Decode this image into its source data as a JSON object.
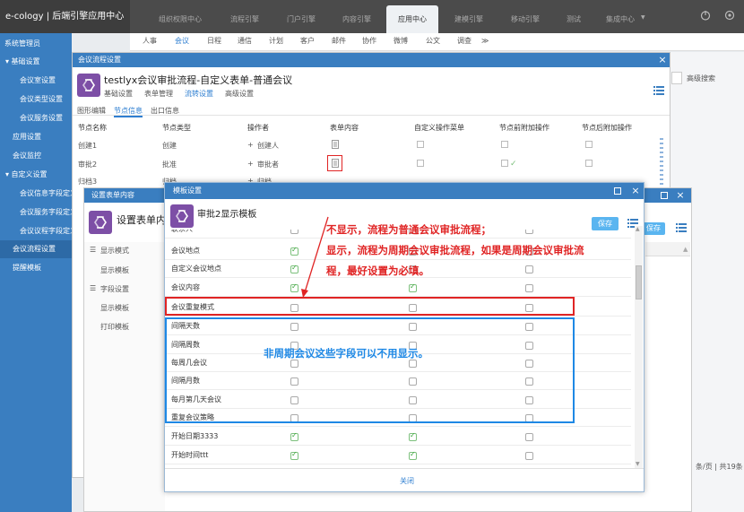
{
  "app": {
    "title": "e-cology | 后端引擎应用中心"
  },
  "top_tabs": [
    "组织权限中心",
    "流程引擎",
    "门户引擎",
    "内容引擎",
    "应用中心",
    "建模引擎",
    "移动引擎",
    "测试",
    "集成中心"
  ],
  "top_active_tab": "应用中心",
  "top_tab_chevron": "▼",
  "top_icons": [
    "power-icon",
    "gear-icon"
  ],
  "sub_nav": [
    "人事",
    "会议",
    "日程",
    "通信",
    "计划",
    "客户",
    "邮件",
    "协作",
    "微博",
    "公文",
    "调查"
  ],
  "sub_nav_active": "会议",
  "sub_nav_more": "≫",
  "sidebar": {
    "header": "系统管理员",
    "items": [
      {
        "label": "▾ 基础设置"
      },
      {
        "label": "会议室设置"
      },
      {
        "label": "会议类型设置"
      },
      {
        "label": "会议服务设置"
      },
      {
        "label": "应用设置"
      },
      {
        "label": "会议监控"
      },
      {
        "label": "▾ 自定义设置"
      },
      {
        "label": "会议信息字段定义"
      },
      {
        "label": "会议服务字段定义"
      },
      {
        "label": "会议议程字段定义"
      },
      {
        "label": "会议流程设置"
      },
      {
        "label": "提醒模板"
      }
    ],
    "selected": "会议流程设置"
  },
  "right_area": {
    "search_label": "高级搜索",
    "pager": "条/页 | 共19条"
  },
  "outer_dialog": {
    "title": "会议流程设置",
    "heading": "testlyx会议审批流程-自定义表单-普通会议",
    "links": [
      "基础设置",
      "表单管理",
      "流转设置",
      "高级设置"
    ],
    "active_link": "流转设置",
    "subtabs": [
      "图形编辑",
      "节点信息",
      "出口信息"
    ],
    "active_subtab": "节点信息",
    "columns": [
      "节点名称",
      "节点类型",
      "操作者",
      "表单内容",
      "自定义操作菜单",
      "节点前附加操作",
      "节点后附加操作"
    ],
    "rows": [
      {
        "name": "创建1",
        "type": "创建",
        "operator": "创建人"
      },
      {
        "name": "审批2",
        "type": "批准",
        "operator": "审批者"
      },
      {
        "name": "归档3",
        "type": "归档",
        "operator": "归档"
      }
    ],
    "operator_prefix": "+"
  },
  "middle_dialog": {
    "title": "设置表单内容",
    "heading": "设置表单内",
    "save_label": "保存",
    "tree": [
      "显示模式",
      "显示模板",
      "字段设置",
      "显示模板",
      "打印模板"
    ]
  },
  "modal": {
    "title": "模板设置",
    "heading": "审批2显示模板",
    "save_label": "保存",
    "close_label": "关闭",
    "top_partial_label": "联系人",
    "fields": [
      {
        "label": "会议地点",
        "c1": true,
        "c2": false,
        "c3": false
      },
      {
        "label": "自定义会议地点",
        "c1": true,
        "c2": false,
        "c3": false
      },
      {
        "label": "会议内容",
        "c1": true,
        "c2": true,
        "c3": false
      },
      {
        "label": "会议重复模式",
        "c1": false,
        "c2": false,
        "c3": false
      },
      {
        "label": "间隔天数",
        "c1": false,
        "c2": false,
        "c3": false
      },
      {
        "label": "间隔周数",
        "c1": false,
        "c2": false,
        "c3": false
      },
      {
        "label": "每周几会议",
        "c1": false,
        "c2": false,
        "c3": false
      },
      {
        "label": "间隔月数",
        "c1": false,
        "c2": false,
        "c3": false
      },
      {
        "label": "每月第几天会议",
        "c1": false,
        "c2": false,
        "c3": false
      },
      {
        "label": "重复会议策略",
        "c1": false,
        "c2": false,
        "c3": false
      },
      {
        "label": "开始日期3333",
        "c1": true,
        "c2": true,
        "c3": false
      },
      {
        "label": "开始时间ttt",
        "c1": true,
        "c2": true,
        "c3": false
      }
    ]
  },
  "annotations": {
    "red_line1": "不显示，流程为普通会议审批流程；",
    "red_line2": "显示，流程为周期会议审批流程，如果是周期会议审批流",
    "red_line3": "程，最好设置为必填。",
    "blue_note": "非周期会议这些字段可以不用显示。",
    "colors": {
      "red": "#e02424",
      "blue": "#1e88e5"
    }
  }
}
